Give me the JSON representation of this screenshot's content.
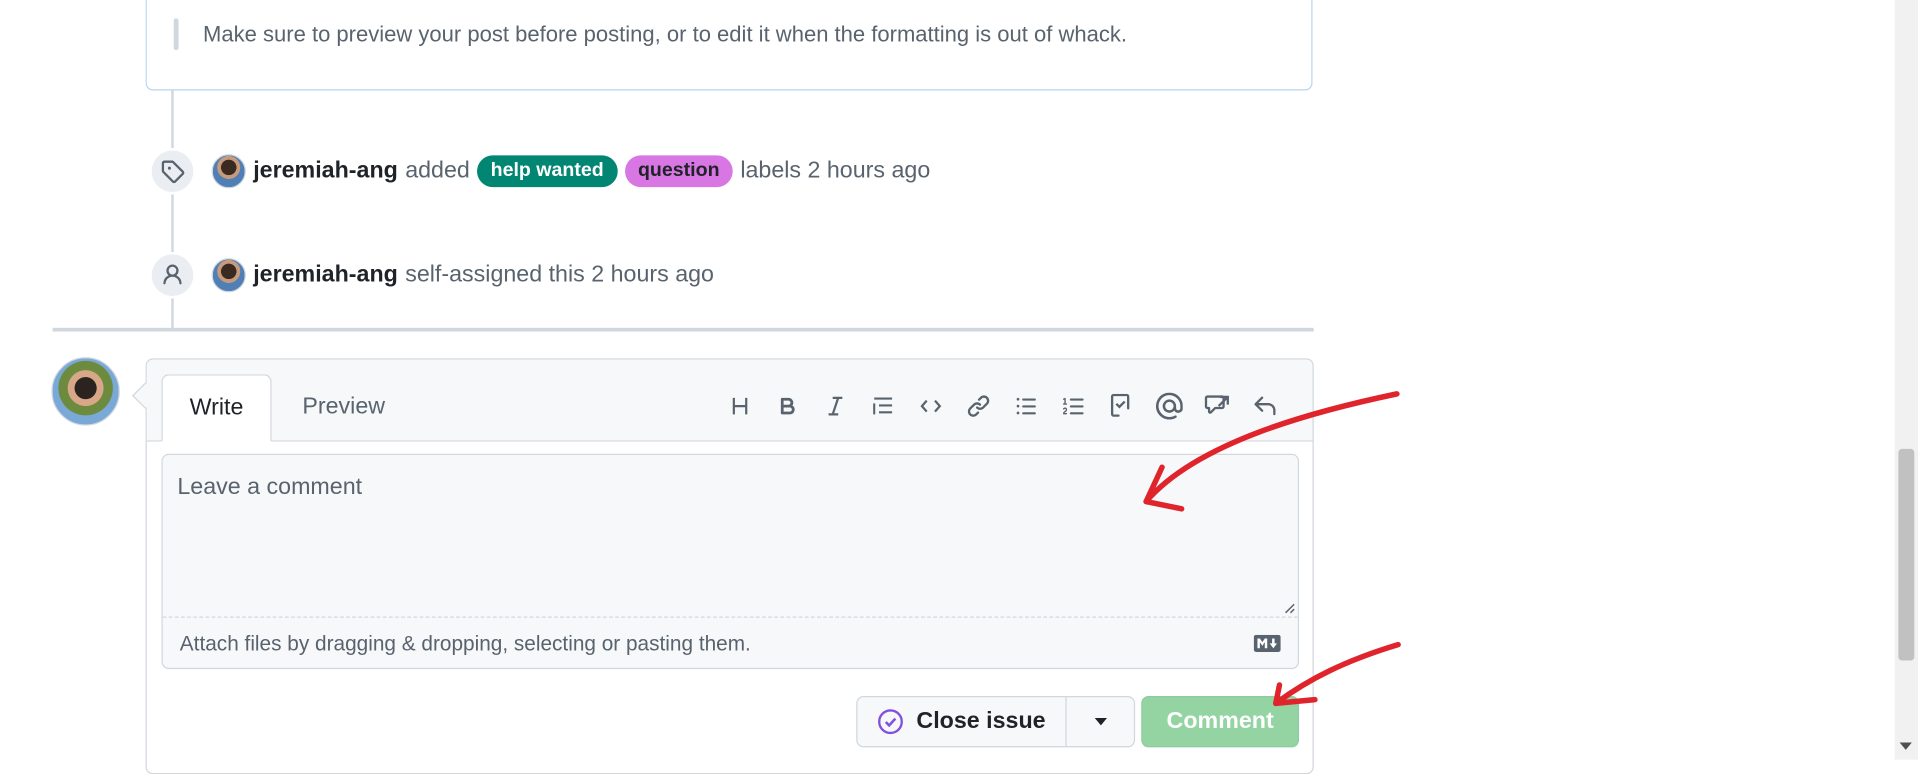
{
  "quote": {
    "text": "Make sure to preview your post before posting, or to edit it when the formatting is out of whack."
  },
  "timeline": {
    "label_event": {
      "actor": "jeremiah-ang",
      "verb": "added",
      "labels": [
        {
          "name": "help wanted",
          "bg": "#008672",
          "fg": "#ffffff"
        },
        {
          "name": "question",
          "bg": "#d876e3",
          "fg": "#1f2328"
        }
      ],
      "suffix": "labels 2 hours ago"
    },
    "assign_event": {
      "actor": "jeremiah-ang",
      "text": "self-assigned this 2 hours ago"
    }
  },
  "composer": {
    "tabs": {
      "write": "Write",
      "preview": "Preview"
    },
    "toolbar": [
      "heading-icon",
      "bold-icon",
      "italic-icon",
      "quote-icon",
      "code-icon",
      "link-icon",
      "unordered-list-icon",
      "ordered-list-icon",
      "task-list-icon",
      "mention-icon",
      "cross-reference-icon",
      "saved-replies-icon"
    ],
    "placeholder": "Leave a comment",
    "attach_text": "Attach files by dragging & dropping, selecting or pasting them.",
    "close_issue_label": "Close issue",
    "comment_label": "Comment"
  },
  "colors": {
    "accent_purple": "#8250df",
    "comment_disabled": "#94d3a2",
    "annotation_red": "#e0242c"
  }
}
